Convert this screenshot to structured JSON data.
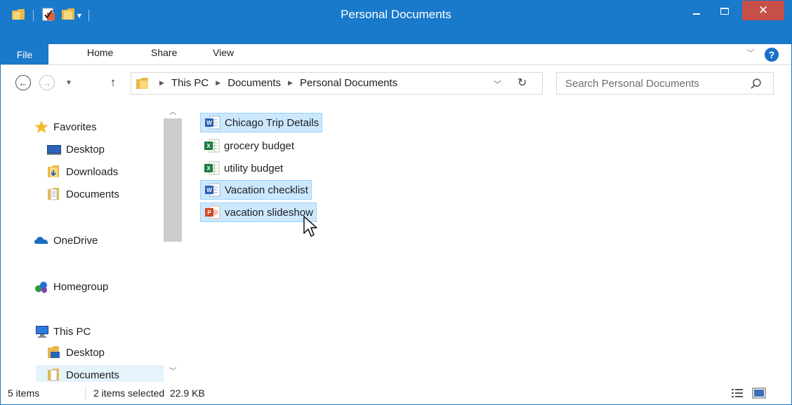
{
  "window": {
    "title": "Personal Documents",
    "accent_color": "#1979ca",
    "close_color": "#c74f4a",
    "controls": {
      "minimize_icon": "minimize-icon",
      "maximize_icon": "maximize-icon",
      "close_icon": "close-icon",
      "close_glyph": "✕"
    }
  },
  "quick_access": [
    "properties-icon",
    "new-folder-icon",
    "folder-icon",
    "customize-toolbar-icon"
  ],
  "ribbon": {
    "tabs": [
      "File",
      "Home",
      "Share",
      "View"
    ],
    "expand_icon": "chevron-down-icon",
    "help_label": "?"
  },
  "navigation": {
    "back_icon": "back-arrow-icon",
    "forward_icon": "forward-arrow-icon",
    "recent_icon": "chevron-down-icon",
    "up_icon": "up-arrow-icon",
    "breadcrumbs": [
      "This PC",
      "Documents",
      "Personal Documents"
    ],
    "search_placeholder": "Search Personal Documents"
  },
  "sidebar": {
    "items": [
      {
        "label": "Favorites",
        "icon": "star-icon"
      },
      {
        "label": "Desktop",
        "icon": "desktop-icon"
      },
      {
        "label": "Downloads",
        "icon": "downloads-icon"
      },
      {
        "label": "Documents",
        "icon": "documents-icon"
      },
      {
        "label": "OneDrive",
        "icon": "onedrive-icon"
      },
      {
        "label": "Homegroup",
        "icon": "homegroup-icon"
      },
      {
        "label": "This PC",
        "icon": "computer-icon"
      },
      {
        "label": "Desktop",
        "icon": "desktop-folder-icon"
      },
      {
        "label": "Documents",
        "icon": "documents-icon"
      }
    ]
  },
  "files": [
    {
      "name": "Chicago Trip Details",
      "type": "word-doc-icon",
      "selected": true
    },
    {
      "name": "grocery budget",
      "type": "excel-sheet-icon",
      "selected": false
    },
    {
      "name": "utility budget",
      "type": "excel-sheet-icon",
      "selected": false
    },
    {
      "name": "Vacation checklist",
      "type": "word-doc-icon",
      "selected": true
    },
    {
      "name": "vacation slideshow",
      "type": "powerpoint-icon",
      "selected": true
    }
  ],
  "status": {
    "item_count": "5 items",
    "selection": "2 items selected  22.9 KB"
  }
}
